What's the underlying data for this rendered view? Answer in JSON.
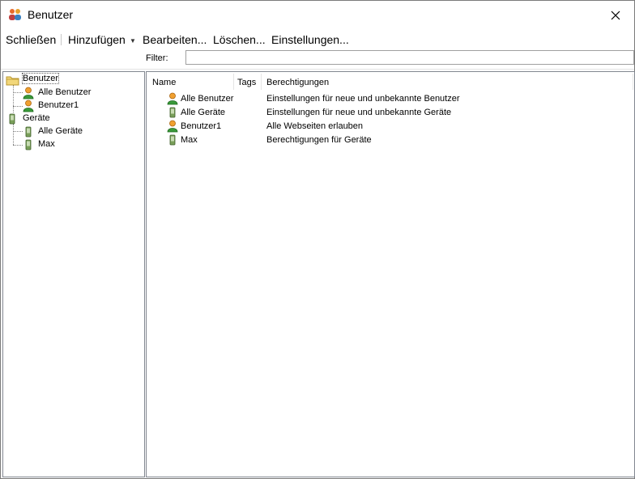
{
  "window": {
    "title": "Benutzer",
    "icon": "users-group-icon",
    "close_icon": "close-icon"
  },
  "menu": {
    "close": "Schließen",
    "add": "Hinzufügen",
    "edit": "Bearbeiten...",
    "delete": "Löschen...",
    "settings": "Einstellungen..."
  },
  "filter": {
    "label": "Filter:",
    "value": ""
  },
  "tree": {
    "users_root": "Benutzer",
    "users_children": [
      "Alle Benutzer",
      "Benutzer1"
    ],
    "devices_root": "Geräte",
    "devices_children": [
      "Alle Geräte",
      "Max"
    ]
  },
  "list": {
    "columns": [
      "Name",
      "Tags",
      "Berechtigungen"
    ],
    "rows": [
      {
        "name": "Alle Benutzer",
        "tags": "",
        "permissions": "Einstellungen für neue und unbekannte Benutzer",
        "icon": "user-icon"
      },
      {
        "name": "Alle Geräte",
        "tags": "",
        "permissions": "Einstellungen für neue und unbekannte Geräte",
        "icon": "device-icon"
      },
      {
        "name": "Benutzer1",
        "tags": "",
        "permissions": "Alle Webseiten erlauben",
        "icon": "user-icon"
      },
      {
        "name": "Max",
        "tags": "",
        "permissions": "Berechtigungen für Geräte",
        "icon": "device-icon"
      }
    ]
  },
  "colors": {
    "user_head": "#f0a030",
    "user_body": "#3a9a3a",
    "device": "#7aa05a",
    "folder": "#f2d77a"
  }
}
